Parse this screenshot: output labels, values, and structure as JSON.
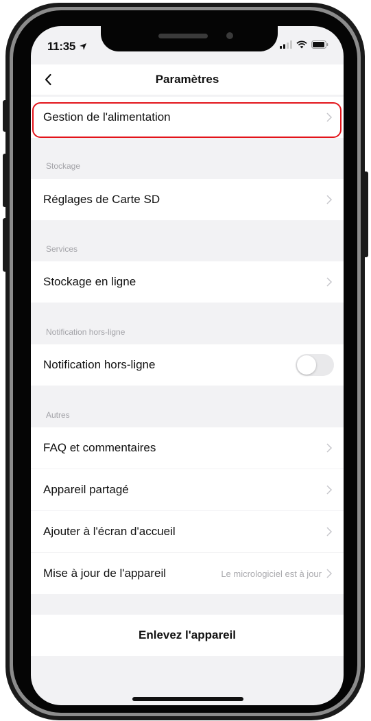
{
  "status_bar": {
    "time": "11:35"
  },
  "header": {
    "title": "Paramètres"
  },
  "rows": {
    "power": "Gestion de l'alimentation",
    "sd_card": "Réglages de Carte SD",
    "cloud": "Stockage en ligne",
    "offline_notif": "Notification hors-ligne",
    "faq": "FAQ et commentaires",
    "shared": "Appareil partagé",
    "home_screen": "Ajouter à l'écran d'accueil",
    "update": "Mise à jour de l'appareil",
    "update_value": "Le micrologiciel est à jour"
  },
  "sections": {
    "storage": "Stockage",
    "services": "Services",
    "offline": "Notification hors-ligne",
    "others": "Autres"
  },
  "remove_device": "Enlevez l'appareil",
  "toggle": {
    "offline_notification_on": false
  },
  "colors": {
    "highlight": "#e3141a",
    "background": "#f2f2f4",
    "chevron": "#c7c7cc"
  }
}
